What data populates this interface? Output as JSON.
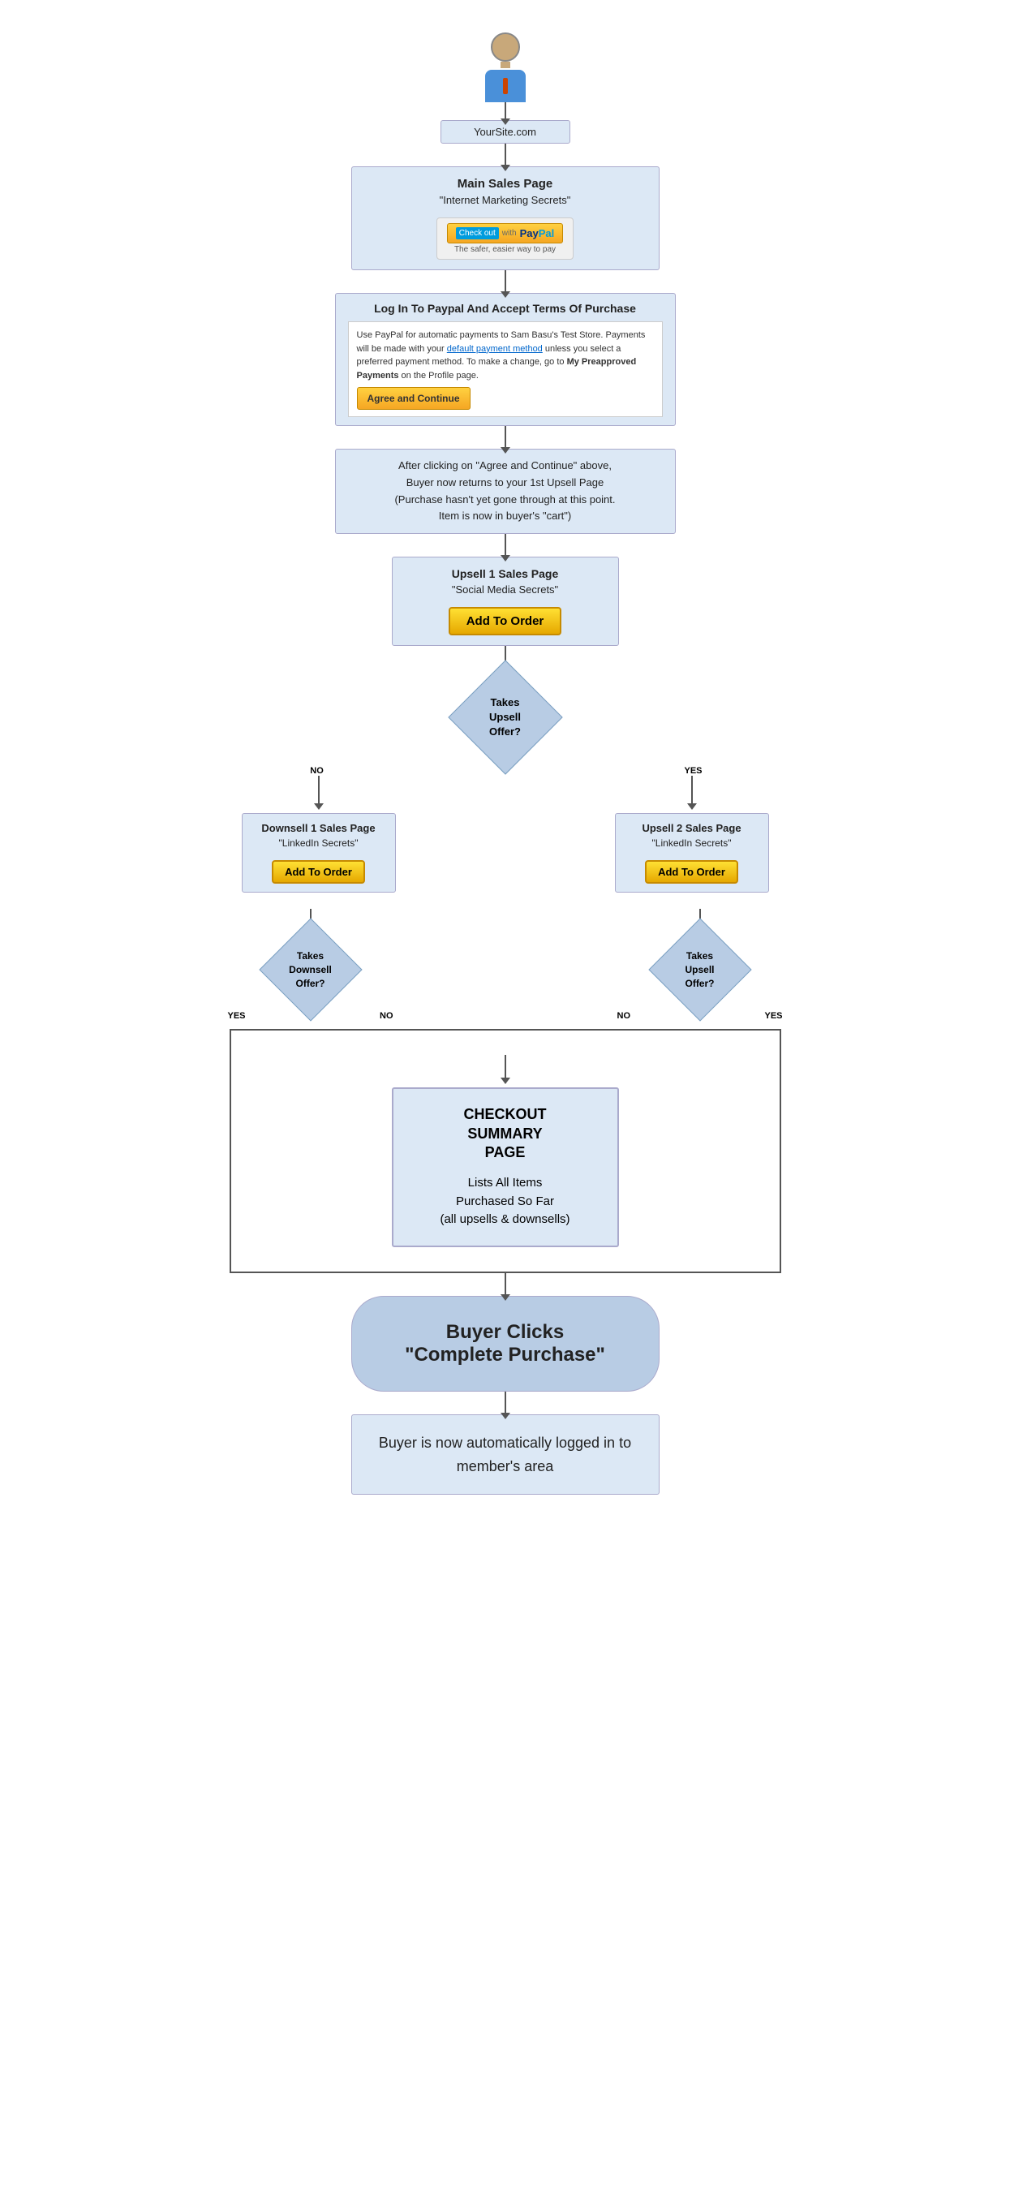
{
  "person": {
    "alt": "Person / Buyer"
  },
  "site_box": {
    "label": "YourSite.com"
  },
  "sales_page_box": {
    "title": "Main Sales Page",
    "subtitle": "\"Internet Marketing Secrets\"",
    "paypal_checkout": "Check out with PayPal",
    "paypal_tagline": "The safer, easier way to pay"
  },
  "paypal_login_box": {
    "title": "Log In To Paypal And Accept Terms Of Purchase",
    "body_line1": "Use PayPal for automatic payments to Sam Basu's Test Store. Payments will be made",
    "body_line2": "with your ",
    "body_link1": "default payment method",
    "body_line3": " unless you select a preferred payment method. To",
    "body_line4": "make a change, go to ",
    "body_link2": "My Preapproved Payments",
    "body_line5": " on the Profile page.",
    "agree_btn": "Agree and Continue"
  },
  "returns_box": {
    "text": "After clicking on \"Agree and Continue\" above, Buyer now returns to your 1st Upsell Page (Purchase hasn't yet gone through at this point. Item is now in buyer's \"cart\")"
  },
  "upsell1_box": {
    "title": "Upsell 1 Sales Page",
    "subtitle": "\"Social Media Secrets\"",
    "btn": "Add To Order"
  },
  "diamond_upsell1": {
    "line1": "Takes",
    "line2": "Upsell",
    "line3": "Offer?"
  },
  "downsell1_box": {
    "title": "Downsell 1 Sales Page",
    "subtitle": "\"LinkedIn Secrets\"",
    "btn": "Add To Order"
  },
  "upsell2_box": {
    "title": "Upsell 2 Sales Page",
    "subtitle": "\"LinkedIn Secrets\"",
    "btn": "Add To Order"
  },
  "diamond_downsell": {
    "line1": "Takes",
    "line2": "Downsell",
    "line3": "Offer?"
  },
  "diamond_upsell2": {
    "line1": "Takes",
    "line2": "Upsell",
    "line3": "Offer?"
  },
  "checkout_summary": {
    "title": "CHECKOUT\nSUMMARY\nPAGE",
    "subtitle": "Lists All Items\nPurchased So Far\n(all upsells & downsells)"
  },
  "buyer_clicks": {
    "text": "Buyer Clicks\n\"Complete Purchase\""
  },
  "final_box": {
    "text": "Buyer is now automatically logged in to member's area"
  },
  "labels": {
    "no": "NO",
    "yes": "YES"
  }
}
